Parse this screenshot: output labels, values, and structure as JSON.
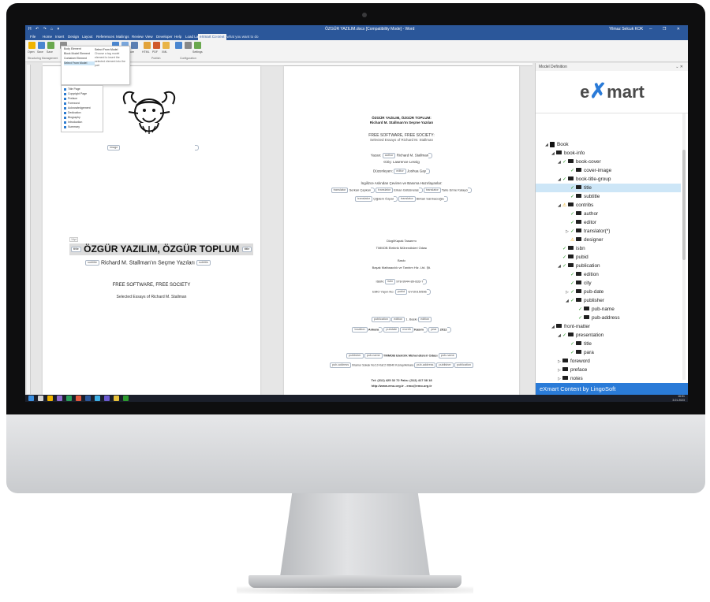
{
  "titlebar": {
    "quick_access": "H ↶ ↷ ⌂ ▾",
    "doc_title": "ÖZGÜR YAZILIM.docx [Compatibility Mode] - Word",
    "user": "Yilmaz Selcuk KOK",
    "window_controls": "─ ❐ ✕"
  },
  "tabs": [
    "File",
    "Home",
    "Insert",
    "Design",
    "Layout",
    "References",
    "Mailings",
    "Review",
    "View",
    "Developer",
    "Help",
    "Load Lab",
    "eXmart Content"
  ],
  "tellme": "Tell me what you want to do",
  "ribbon": {
    "buttons": [
      "Open",
      "Save",
      "Save",
      "Insert",
      "Insert Element",
      "Document Structure",
      "Show Hidden",
      "Table of Contents",
      "HTML",
      "PDF",
      "XML",
      "Add to Schema",
      "Model Schema",
      "Settings"
    ],
    "groups": [
      "Structuring Management",
      "Publish",
      "Configuration"
    ]
  },
  "dropdown": {
    "items": [
      "Body Element",
      "Block Model Element",
      "Container Element",
      "Select From Model"
    ],
    "highlighted_index": 3,
    "side_title": "Select From Model",
    "side_text": "Choose a tag model element to insert the selected element into the part"
  },
  "submenu": {
    "items": [
      "Title Page",
      "Copyright Page",
      "Preface",
      "Foreword",
      "Acknowledgement",
      "Dedication",
      "Biography",
      "Introduction",
      "Summary"
    ]
  },
  "page1": {
    "image_tag": "image",
    "size_label": "16pt",
    "title_tag": "title",
    "title": "ÖZGÜR YAZILIM, ÖZGÜR TOPLUM",
    "subtitle_tag": "subtitle",
    "subtitle": "Richard M. Stallman'ın Seçme Yazıları",
    "free_software": "FREE SOFTWARE, FREE SOCIETY",
    "selected_essays": "Selected Essays of Richard M. Stallman"
  },
  "page2": {
    "title_line1": "ÖZGÜR YAZILIM, ÖZGÜR TOPLUM:",
    "title_line2": "Richard M. Stallman'ın Seçme Yazıları",
    "free_software": "FREE SOFTWARE, FREE SOCIETY:",
    "selected_essays": "Selected Essays of Richard M. Stallman",
    "author_prefix": "Yazan:",
    "author_tag": "author",
    "author_name": "Richard M. Stallman",
    "giris": "Giriş: Lawrence Lessig",
    "editor_prefix": "Düzenleyen:",
    "editor_tag": "editor",
    "editor_name": "Joshua Gay",
    "translators_heading": "İngilizce Aslından Çeviren ve Basıma Hazırlayanlar:",
    "translator_tag": "translator",
    "translator1": "Serkan Çapkan",
    "translator2": "Erkan Gülsünelas",
    "translator3": "Tarle Emre Kalaycı",
    "translator4": "Çiğdem Özpat",
    "translator5": "Birkan Sarıbacıoğlu",
    "cover_design": "Dizgi/Kapak Tasarımı",
    "cover_org": "TMMOB Elektrik Mühendisleri Odası",
    "baski": "Baskı",
    "printer": "Başak Matbaacılık ve Tanıtım Hiz. Ltd. Şti.",
    "isbn_prefix": "ISBN:",
    "isbn_tag": "isbn",
    "isbn": "978-9944-89-833-7",
    "emo_prefix": "EMO Yayın No:",
    "pubid_tag": "pubid",
    "pubid": "GY/2015/596",
    "publication_tag": "publication",
    "edition_tag": "edition",
    "edition": "1. Baskı",
    "location_tag": "location",
    "location": "Ankara",
    "pubdate_tag": "pubdate",
    "month_tag": "month",
    "month": "Kasım",
    "year_tag": "year",
    "year": "2012",
    "publisher_tag": "publisher",
    "pubname_tag": "pub-name",
    "publisher_name": "TMMOB Elektrik Mühendisleri Odası",
    "pubaddress_tag": "pub-address",
    "address": "Ihlamur Sokak No:10 Kat:2 06640 Kızılay/Ankara",
    "phone": "Tel: (312) 425 32 72 Faks: (312) 417 38 18",
    "web": "http://www.emo.org.tr - emo@emo.org.tr"
  },
  "pane": {
    "header": "Model Definition",
    "close": "⌄ ✕",
    "logo_pre": "e",
    "logo_x": "✗",
    "logo_post": "mart",
    "banner": "eXmart Content by LingoSoft",
    "tree": [
      {
        "label": "Book",
        "indent": 0,
        "arrow": "◢",
        "check": "",
        "selected": false
      },
      {
        "label": "book-info",
        "indent": 1,
        "arrow": "◢",
        "check": "",
        "selected": false
      },
      {
        "label": "book-cover",
        "indent": 2,
        "arrow": "◢",
        "check": "✓",
        "selected": false
      },
      {
        "label": "cover-image",
        "indent": 3,
        "arrow": "",
        "check": "✓",
        "selected": false
      },
      {
        "label": "book-title-group",
        "indent": 2,
        "arrow": "◢",
        "check": "✓",
        "selected": false
      },
      {
        "label": "title",
        "indent": 3,
        "arrow": "",
        "check": "✓",
        "selected": true
      },
      {
        "label": "subtitle",
        "indent": 3,
        "arrow": "",
        "check": "✓",
        "selected": false
      },
      {
        "label": "contribs",
        "indent": 2,
        "arrow": "◢",
        "check": "⚠",
        "selected": false
      },
      {
        "label": "author",
        "indent": 3,
        "arrow": "",
        "check": "✓",
        "selected": false
      },
      {
        "label": "editor",
        "indent": 3,
        "arrow": "",
        "check": "✓",
        "selected": false
      },
      {
        "label": "translator(*)",
        "indent": 3,
        "arrow": "▷",
        "check": "✓",
        "selected": false
      },
      {
        "label": "designer",
        "indent": 3,
        "arrow": "",
        "check": "⚠",
        "selected": false
      },
      {
        "label": "isbn",
        "indent": 2,
        "arrow": "",
        "check": "✓",
        "selected": false
      },
      {
        "label": "pubid",
        "indent": 2,
        "arrow": "",
        "check": "✓",
        "selected": false
      },
      {
        "label": "publication",
        "indent": 2,
        "arrow": "◢",
        "check": "✓",
        "selected": false
      },
      {
        "label": "edition",
        "indent": 3,
        "arrow": "",
        "check": "✓",
        "selected": false
      },
      {
        "label": "city",
        "indent": 3,
        "arrow": "",
        "check": "✓",
        "selected": false
      },
      {
        "label": "pub-date",
        "indent": 3,
        "arrow": "▷",
        "check": "✓",
        "selected": false
      },
      {
        "label": "publisher",
        "indent": 3,
        "arrow": "◢",
        "check": "✓",
        "selected": false
      },
      {
        "label": "pub-name",
        "indent": 4,
        "arrow": "",
        "check": "✓",
        "selected": false
      },
      {
        "label": "pub-address",
        "indent": 4,
        "arrow": "",
        "check": "✓",
        "selected": false
      },
      {
        "label": "front-matter",
        "indent": 1,
        "arrow": "◢",
        "check": "",
        "selected": false
      },
      {
        "label": "presentation",
        "indent": 2,
        "arrow": "◢",
        "check": "✓",
        "selected": false
      },
      {
        "label": "title",
        "indent": 3,
        "arrow": "",
        "check": "✓",
        "selected": false
      },
      {
        "label": "para",
        "indent": 3,
        "arrow": "",
        "check": "✓",
        "selected": false
      },
      {
        "label": "foreword",
        "indent": 2,
        "arrow": "▷",
        "check": "",
        "selected": false
      },
      {
        "label": "preface",
        "indent": 2,
        "arrow": "▷",
        "check": "",
        "selected": false
      },
      {
        "label": "notes",
        "indent": 2,
        "arrow": "▷",
        "check": "",
        "selected": false
      }
    ]
  },
  "statusbar": {
    "left": "Page 1 of 106   9 of 27724 words   Turkish (Turkey)   Accessibility: Investigate",
    "right": "100%"
  },
  "taskbar": {
    "time": "16:51",
    "date": "3.01.2023"
  },
  "colors": {
    "word_blue": "#2b579a",
    "exmart_blue": "#2a7bd8",
    "check_green": "#2e9a2e",
    "warn_orange": "#e8a400",
    "selection": "#cde6f7"
  }
}
